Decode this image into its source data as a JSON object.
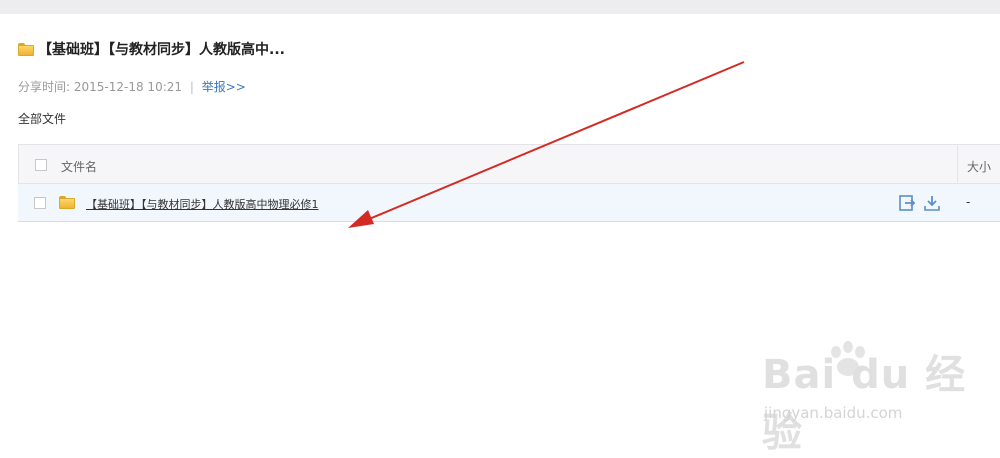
{
  "share": {
    "title": "【基础班】【与教材同步】人教版高中...",
    "share_time_label": "分享时间:",
    "share_time": "2015-12-18 10:21",
    "separator": "|",
    "report_link": "举报>>"
  },
  "breadcrumb": {
    "all_files": "全部文件"
  },
  "table": {
    "columns": {
      "name": "文件名",
      "size": "大小"
    },
    "rows": [
      {
        "name": "【基础班】【与教材同步】人教版高中物理必修1",
        "size": "-",
        "icon": "folder-icon"
      }
    ]
  },
  "watermark": {
    "main": "Bai du 经验",
    "sub": "jingyan.baidu.com"
  },
  "colors": {
    "arrow": "#d42a24",
    "link": "#3a78b8",
    "folder": "#f0b332",
    "row_highlight": "#f1f7fd"
  }
}
